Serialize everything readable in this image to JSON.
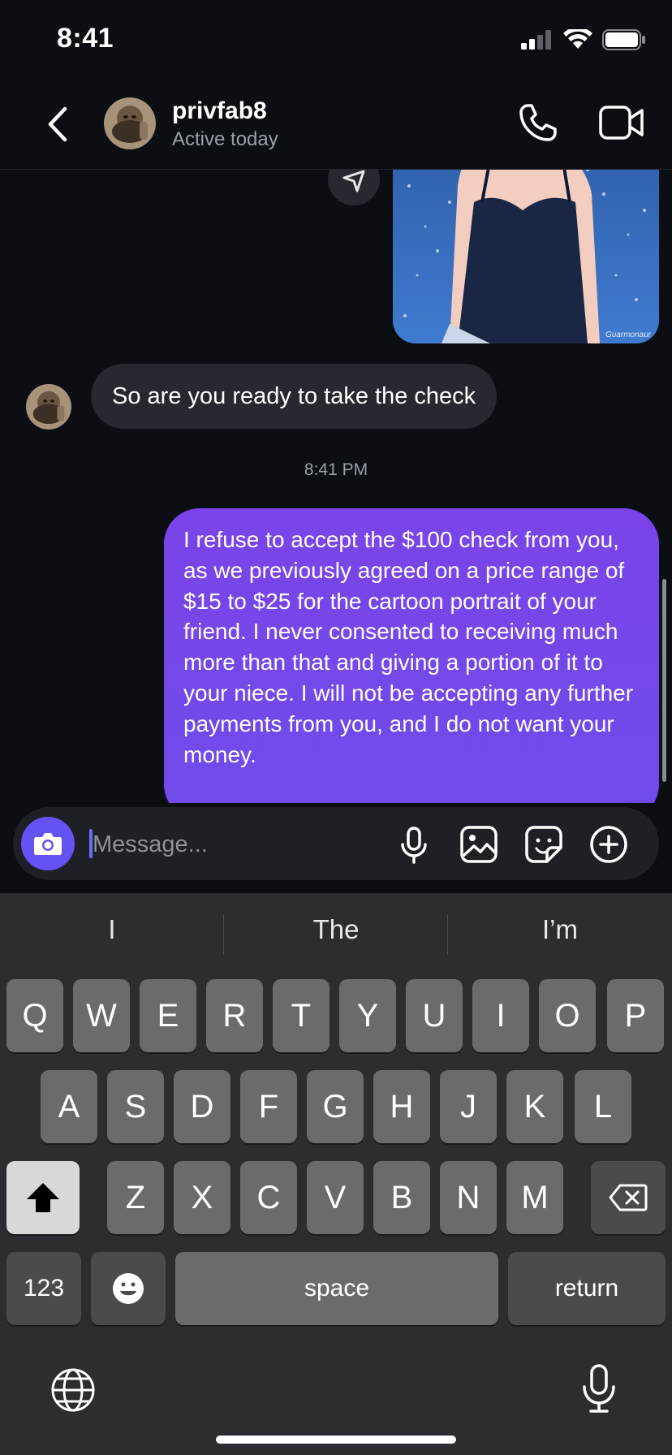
{
  "status_bar": {
    "time": "8:41"
  },
  "header": {
    "username": "privfab8",
    "status": "Active today"
  },
  "chat": {
    "incoming_message": "So are you ready to take the check",
    "timestamp": "8:41 PM",
    "outgoing_message": "I refuse to accept the $100 check from you, as we previously agreed on a price range of $15 to $25 for the cartoon portrait of your friend. I never consented to receiving much more than that and giving a portion of it to your niece. I will not be accepting any further payments from you, and I do not want your money.",
    "artwork_signature": "Guarmonaur"
  },
  "composer": {
    "placeholder": "Message..."
  },
  "keyboard": {
    "suggestions": [
      "I",
      "The",
      "I’m"
    ],
    "row1": [
      "Q",
      "W",
      "E",
      "R",
      "T",
      "Y",
      "U",
      "I",
      "O",
      "P"
    ],
    "row2": [
      "A",
      "S",
      "D",
      "F",
      "G",
      "H",
      "J",
      "K",
      "L"
    ],
    "row3": [
      "Z",
      "X",
      "C",
      "V",
      "B",
      "N",
      "M"
    ],
    "numbers_label": "123",
    "space_label": "space",
    "return_label": "return"
  },
  "colors": {
    "accent": "#6552f4",
    "bubble_out": "#7444e8",
    "bubble_in": "#262a30"
  }
}
